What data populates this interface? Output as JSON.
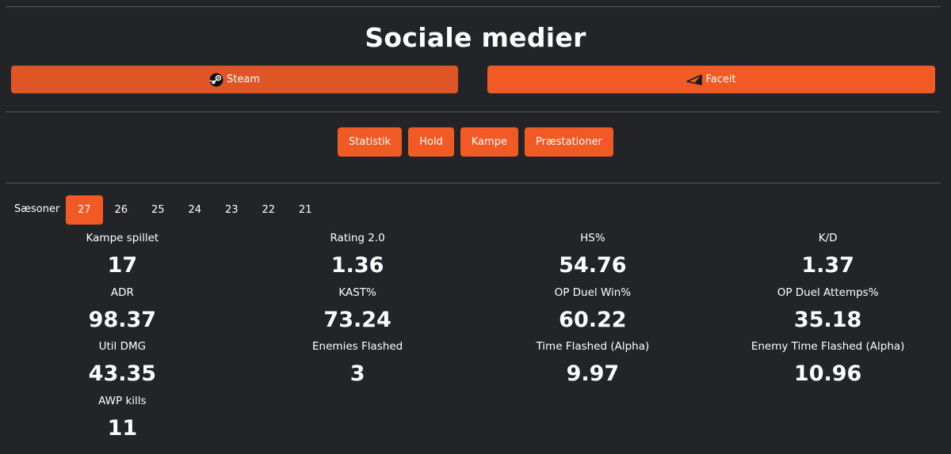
{
  "social": {
    "title": "Sociale medier",
    "steam_label": "Steam",
    "faceit_label": "Faceit"
  },
  "nav": {
    "items": [
      {
        "label": "Statistik"
      },
      {
        "label": "Hold"
      },
      {
        "label": "Kampe"
      },
      {
        "label": "Præstationer"
      }
    ]
  },
  "seasons": {
    "label": "Sæsoner",
    "items": [
      "27",
      "26",
      "25",
      "24",
      "23",
      "22",
      "21"
    ],
    "active": "27"
  },
  "stats": [
    {
      "label": "Kampe spillet",
      "value": "17"
    },
    {
      "label": "Rating 2.0",
      "value": "1.36"
    },
    {
      "label": "HS%",
      "value": "54.76"
    },
    {
      "label": "K/D",
      "value": "1.37"
    },
    {
      "label": "ADR",
      "value": "98.37"
    },
    {
      "label": "KAST%",
      "value": "73.24"
    },
    {
      "label": "OP Duel Win%",
      "value": "60.22"
    },
    {
      "label": "OP Duel Attemps%",
      "value": "35.18"
    },
    {
      "label": "Util DMG",
      "value": "43.35"
    },
    {
      "label": "Enemies Flashed",
      "value": "3"
    },
    {
      "label": "Time Flashed (Alpha)",
      "value": "9.97"
    },
    {
      "label": "Enemy Time Flashed (Alpha)",
      "value": "10.96"
    },
    {
      "label": "AWP kills",
      "value": "11"
    }
  ],
  "colors": {
    "background": "#222428",
    "accent": "#f15a24",
    "divider": "#55585d"
  },
  "icons": {
    "steam": "steam-icon",
    "faceit": "faceit-icon"
  }
}
